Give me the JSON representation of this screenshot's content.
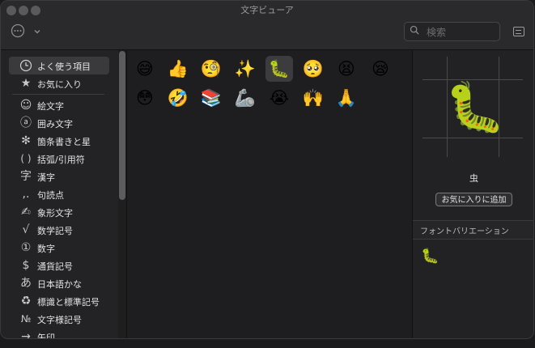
{
  "window": {
    "title": "文字ビューア"
  },
  "toolbar": {
    "search_placeholder": "検索"
  },
  "sidebar": {
    "items": [
      {
        "icon": "clock-icon",
        "glyph": "🕘",
        "label": "よく使う項目"
      },
      {
        "icon": "star-icon",
        "glyph": "★",
        "label": "お気に入り"
      },
      {
        "icon": "smiley-icon",
        "glyph": "☺",
        "label": "絵文字"
      },
      {
        "icon": "circled-a-icon",
        "glyph": "ⓐ",
        "label": "囲み文字"
      },
      {
        "icon": "asterisk-icon",
        "glyph": "✻",
        "label": "箇条書きと星"
      },
      {
        "icon": "parentheses-icon",
        "glyph": "( )",
        "label": "括弧/引用符"
      },
      {
        "icon": "kanji-icon",
        "glyph": "字",
        "label": "漢字"
      },
      {
        "icon": "punctuation-icon",
        "glyph": ",.",
        "label": "句読点"
      },
      {
        "icon": "pictograph-icon",
        "glyph": "✍",
        "label": "象形文字"
      },
      {
        "icon": "sqrt-icon",
        "glyph": "√",
        "label": "数学記号"
      },
      {
        "icon": "circled-one-icon",
        "glyph": "①",
        "label": "数字"
      },
      {
        "icon": "dollar-icon",
        "glyph": "$",
        "label": "通貨記号"
      },
      {
        "icon": "hiragana-icon",
        "glyph": "あ",
        "label": "日本語かな"
      },
      {
        "icon": "recycle-icon",
        "glyph": "♻",
        "label": "標識と標準記号"
      },
      {
        "icon": "numero-icon",
        "glyph": "№",
        "label": "文字様記号"
      },
      {
        "icon": "arrow-icon",
        "glyph": "→",
        "label": "矢印"
      }
    ]
  },
  "emoji_grid": [
    "😅",
    "👍",
    "🧐",
    "✨",
    "🐛",
    "🥺",
    "😫",
    "😪",
    "😳",
    "🤣",
    "📚",
    "🦾",
    "😭",
    "🙌",
    "🙏"
  ],
  "detail": {
    "selected_emoji": "🐛",
    "name": "虫",
    "favorite_button": "お気に入りに追加",
    "font_variations_label": "フォントバリエーション",
    "variations": [
      "🐛"
    ]
  }
}
